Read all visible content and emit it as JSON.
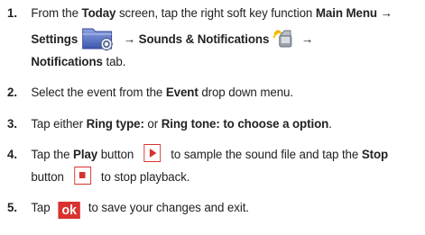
{
  "steps": [
    {
      "number": "1.",
      "p1": "From the ",
      "b1": "Today",
      "p2": " screen, tap the right soft key function ",
      "b2": "Main Menu",
      "arrow1": " → ",
      "b3": "Settings",
      "arrow2": " → ",
      "b4": "Sounds & Notifications",
      "arrow3": " → ",
      "b5": "Notifications",
      "p3": " tab."
    },
    {
      "number": "2.",
      "p1": "Select the event from the ",
      "b1": "Event",
      "p2": " drop down menu."
    },
    {
      "number": "3.",
      "p1": "Tap either ",
      "b1": "Ring type:",
      "p2": " or ",
      "b2": "Ring tone: to choose a option",
      "p3": "."
    },
    {
      "number": "4.",
      "p1": " Tap the ",
      "b1": "Play",
      "p2": " button ",
      "p3": " to sample the sound file and tap the ",
      "b2": "Stop",
      "p4": " button ",
      "p5": " to stop playback."
    },
    {
      "number": "5.",
      "p1": "Tap ",
      "ok_label": "ok",
      "p2": " to save your changes and exit."
    }
  ],
  "icons": {
    "settings": "settings-folder-icon",
    "sounds": "sounds-notifications-icon",
    "play": "play-icon",
    "stop": "stop-icon",
    "ok": "ok-soft-key-icon"
  },
  "colors": {
    "accent_red": "#d8332f",
    "folder_blue": "#5a74c8",
    "text": "#222222"
  }
}
